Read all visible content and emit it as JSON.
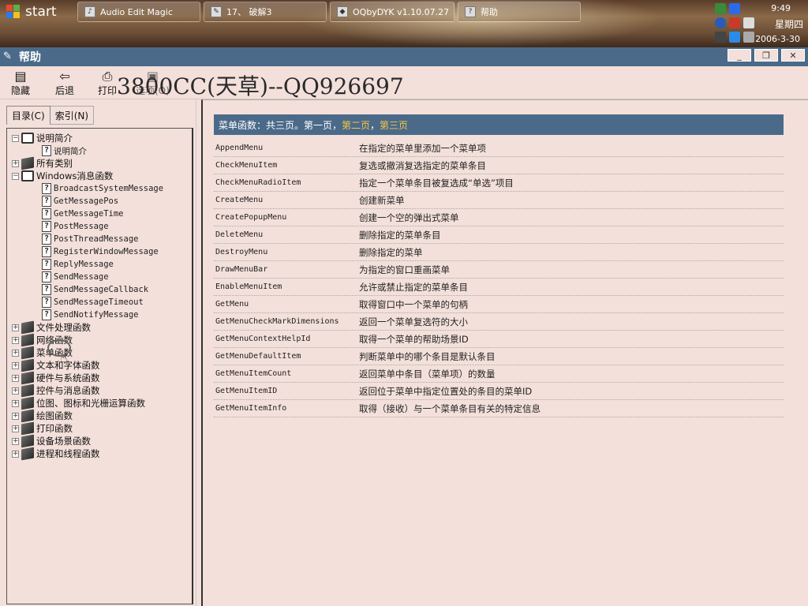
{
  "taskbar": {
    "start_label": "start",
    "tasks": [
      {
        "label": "Audio Edit Magic"
      },
      {
        "label": "17、 破解3"
      },
      {
        "label": "OQbyDYK v1.10.07.27"
      },
      {
        "label": "帮助"
      }
    ],
    "clock": {
      "time": "9:49",
      "weekday": "星期四",
      "date": "2006-3-30"
    }
  },
  "window": {
    "title": "帮助",
    "minimize": "_",
    "restore": "❐",
    "close": "✕"
  },
  "toolbar": {
    "hide_label": "隐藏",
    "back_label": "后退",
    "print_label": "打印",
    "options_label": "选项(O)",
    "watermark": "3800CC(天草)--QQ926697"
  },
  "left": {
    "tab_contents": "目录(C)",
    "tab_index": "索引(N)",
    "tree": [
      {
        "level": 1,
        "expander": "−",
        "icon": "book-open",
        "label": "说明简介"
      },
      {
        "level": 2,
        "icon": "help",
        "label": "说明简介"
      },
      {
        "level": 1,
        "expander": "+",
        "icon": "book-closed",
        "label": "所有类别"
      },
      {
        "level": 1,
        "expander": "−",
        "icon": "book-open",
        "label": "Windows消息函数"
      },
      {
        "level": 2,
        "icon": "help",
        "label": "BroadcastSystemMessage"
      },
      {
        "level": 2,
        "icon": "help",
        "label": "GetMessagePos"
      },
      {
        "level": 2,
        "icon": "help",
        "label": "GetMessageTime"
      },
      {
        "level": 2,
        "icon": "help",
        "label": "PostMessage"
      },
      {
        "level": 2,
        "icon": "help",
        "label": "PostThreadMessage"
      },
      {
        "level": 2,
        "icon": "help",
        "label": "RegisterWindowMessage"
      },
      {
        "level": 2,
        "icon": "help",
        "label": "ReplyMessage"
      },
      {
        "level": 2,
        "icon": "help",
        "label": "SendMessage"
      },
      {
        "level": 2,
        "icon": "help",
        "label": "SendMessageCallback"
      },
      {
        "level": 2,
        "icon": "help",
        "label": "SendMessageTimeout"
      },
      {
        "level": 2,
        "icon": "help",
        "label": "SendNotifyMessage"
      },
      {
        "level": 1,
        "expander": "+",
        "icon": "book-closed",
        "label": "文件处理函数"
      },
      {
        "level": 1,
        "expander": "+",
        "icon": "book-closed",
        "label": "网络函数"
      },
      {
        "level": 1,
        "expander": "+",
        "icon": "book-closed",
        "label": "菜单函数"
      },
      {
        "level": 1,
        "expander": "+",
        "icon": "book-closed",
        "label": "文本和字体函数"
      },
      {
        "level": 1,
        "expander": "+",
        "icon": "book-closed",
        "label": "硬件与系统函数"
      },
      {
        "level": 1,
        "expander": "+",
        "icon": "book-closed",
        "label": "控件与消息函数"
      },
      {
        "level": 1,
        "expander": "+",
        "icon": "book-closed",
        "label": "位图、图标和光栅运算函数"
      },
      {
        "level": 1,
        "expander": "+",
        "icon": "book-closed",
        "label": "绘图函数"
      },
      {
        "level": 1,
        "expander": "+",
        "icon": "book-closed",
        "label": "打印函数"
      },
      {
        "level": 1,
        "expander": "+",
        "icon": "book-closed",
        "label": "设备场景函数"
      },
      {
        "level": 1,
        "expander": "+",
        "icon": "book-closed",
        "label": "进程和线程函数"
      }
    ]
  },
  "content": {
    "header_prefix": "菜单函数：共三页。第一页，",
    "header_page2": "第二页",
    "header_sep": "，",
    "header_page3": "第三页",
    "functions": [
      {
        "name": "AppendMenu",
        "desc": "在指定的菜单里添加一个菜单项"
      },
      {
        "name": "CheckMenuItem",
        "desc": "复选或撤消复选指定的菜单条目"
      },
      {
        "name": "CheckMenuRadioItem",
        "desc": "指定一个菜单条目被复选成“单选”项目"
      },
      {
        "name": "CreateMenu",
        "desc": "创建新菜单"
      },
      {
        "name": "CreatePopupMenu",
        "desc": "创建一个空的弹出式菜单"
      },
      {
        "name": "DeleteMenu",
        "desc": "删除指定的菜单条目"
      },
      {
        "name": "DestroyMenu",
        "desc": "删除指定的菜单"
      },
      {
        "name": "DrawMenuBar",
        "desc": "为指定的窗口重画菜单"
      },
      {
        "name": "EnableMenuItem",
        "desc": "允许或禁止指定的菜单条目"
      },
      {
        "name": "GetMenu",
        "desc": "取得窗口中一个菜单的句柄"
      },
      {
        "name": "GetMenuCheckMarkDimensions",
        "desc": "返回一个菜单复选符的大小"
      },
      {
        "name": "GetMenuContextHelpId",
        "desc": "取得一个菜单的帮助场景ID"
      },
      {
        "name": "GetMenuDefaultItem",
        "desc": "判断菜单中的哪个条目是默认条目"
      },
      {
        "name": "GetMenuItemCount",
        "desc": "返回菜单中条目（菜单项）的数量"
      },
      {
        "name": "GetMenuItemID",
        "desc": "返回位于菜单中指定位置处的条目的菜单ID"
      },
      {
        "name": "GetMenuItemInfo",
        "desc": "取得（接收）与一个菜单条目有关的特定信息"
      }
    ]
  },
  "colors": {
    "background": "#f3e0da",
    "header_bar": "#4b6a8a",
    "link": "#f5c542"
  }
}
